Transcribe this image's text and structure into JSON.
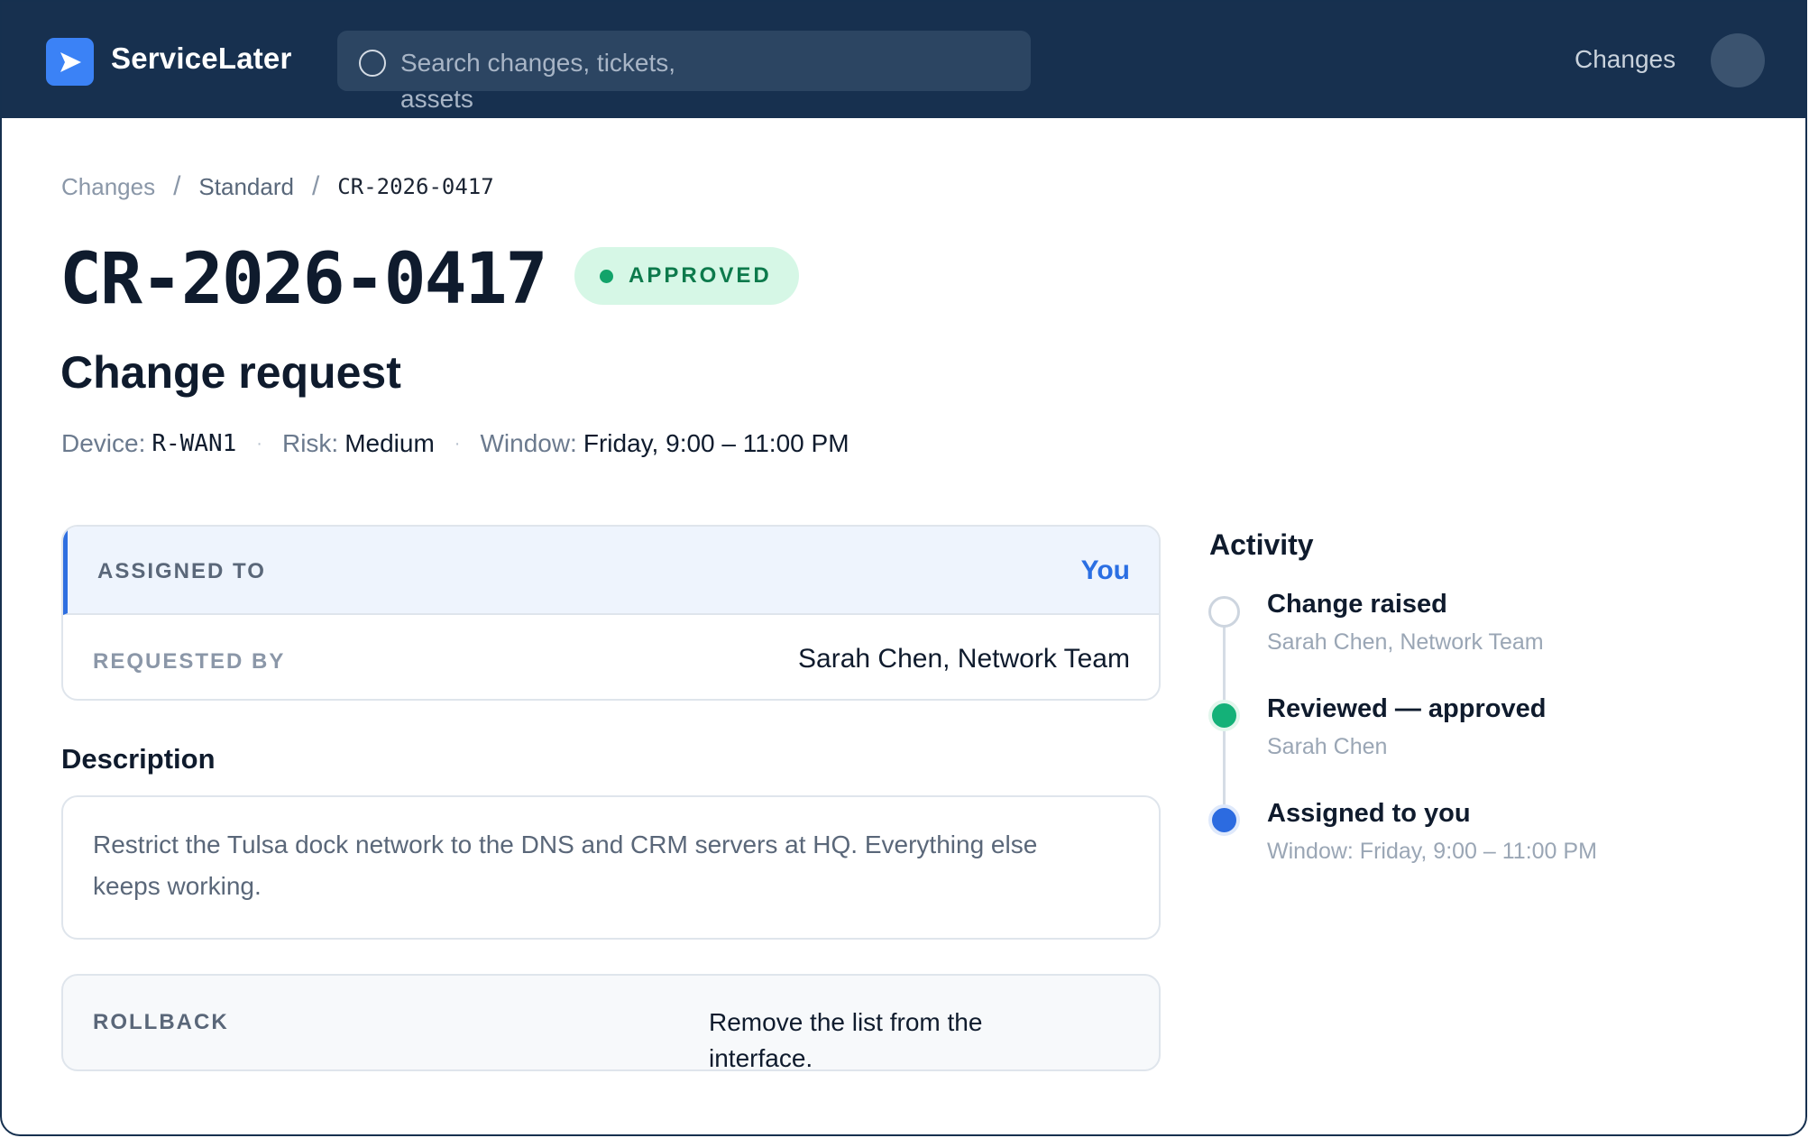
{
  "header": {
    "brand": "ServiceLater",
    "search_placeholder": "Search changes, tickets, assets",
    "nav_changes": "Changes"
  },
  "breadcrumb": {
    "items": [
      "Changes",
      "Standard"
    ],
    "separator": "/",
    "current": "CR-2026-0417"
  },
  "change": {
    "id": "CR-2026-0417",
    "status": "APPROVED",
    "type_title": "Change request",
    "device_label": "Device:",
    "device_value": "R-WAN1",
    "risk_label": "Risk:",
    "risk_value": "Medium",
    "window_label": "Window:",
    "window_value": "Friday, 9:00 – 11:00 PM"
  },
  "details": {
    "assigned_label": "ASSIGNED TO",
    "assigned_value": "You",
    "requested_label": "REQUESTED BY",
    "requested_value": "Sarah Chen, Network Team"
  },
  "description": {
    "heading": "Description",
    "text": "Restrict the Tulsa dock network to the DNS and CRM servers at HQ. Everything else keeps working."
  },
  "rollback": {
    "label": "ROLLBACK",
    "value": "Remove the list from the interface."
  },
  "activity": {
    "heading": "Activity",
    "items": [
      {
        "title": "Change raised",
        "subtitle": "Sarah Chen, Network Team",
        "state": "pending"
      },
      {
        "title": "Reviewed — approved",
        "subtitle": "Sarah Chen",
        "state": "approved"
      },
      {
        "title": "Assigned to you",
        "subtitle": "Window: Friday, 9:00 – 11:00 PM",
        "state": "current"
      }
    ]
  },
  "colors": {
    "header_bg": "#17304f",
    "accent": "#2b6fe3",
    "approved_green": "#12a36a",
    "badge_bg": "#d6f7e6"
  },
  "icons": {
    "logo": "send-arrow-icon",
    "search": "search-icon"
  }
}
